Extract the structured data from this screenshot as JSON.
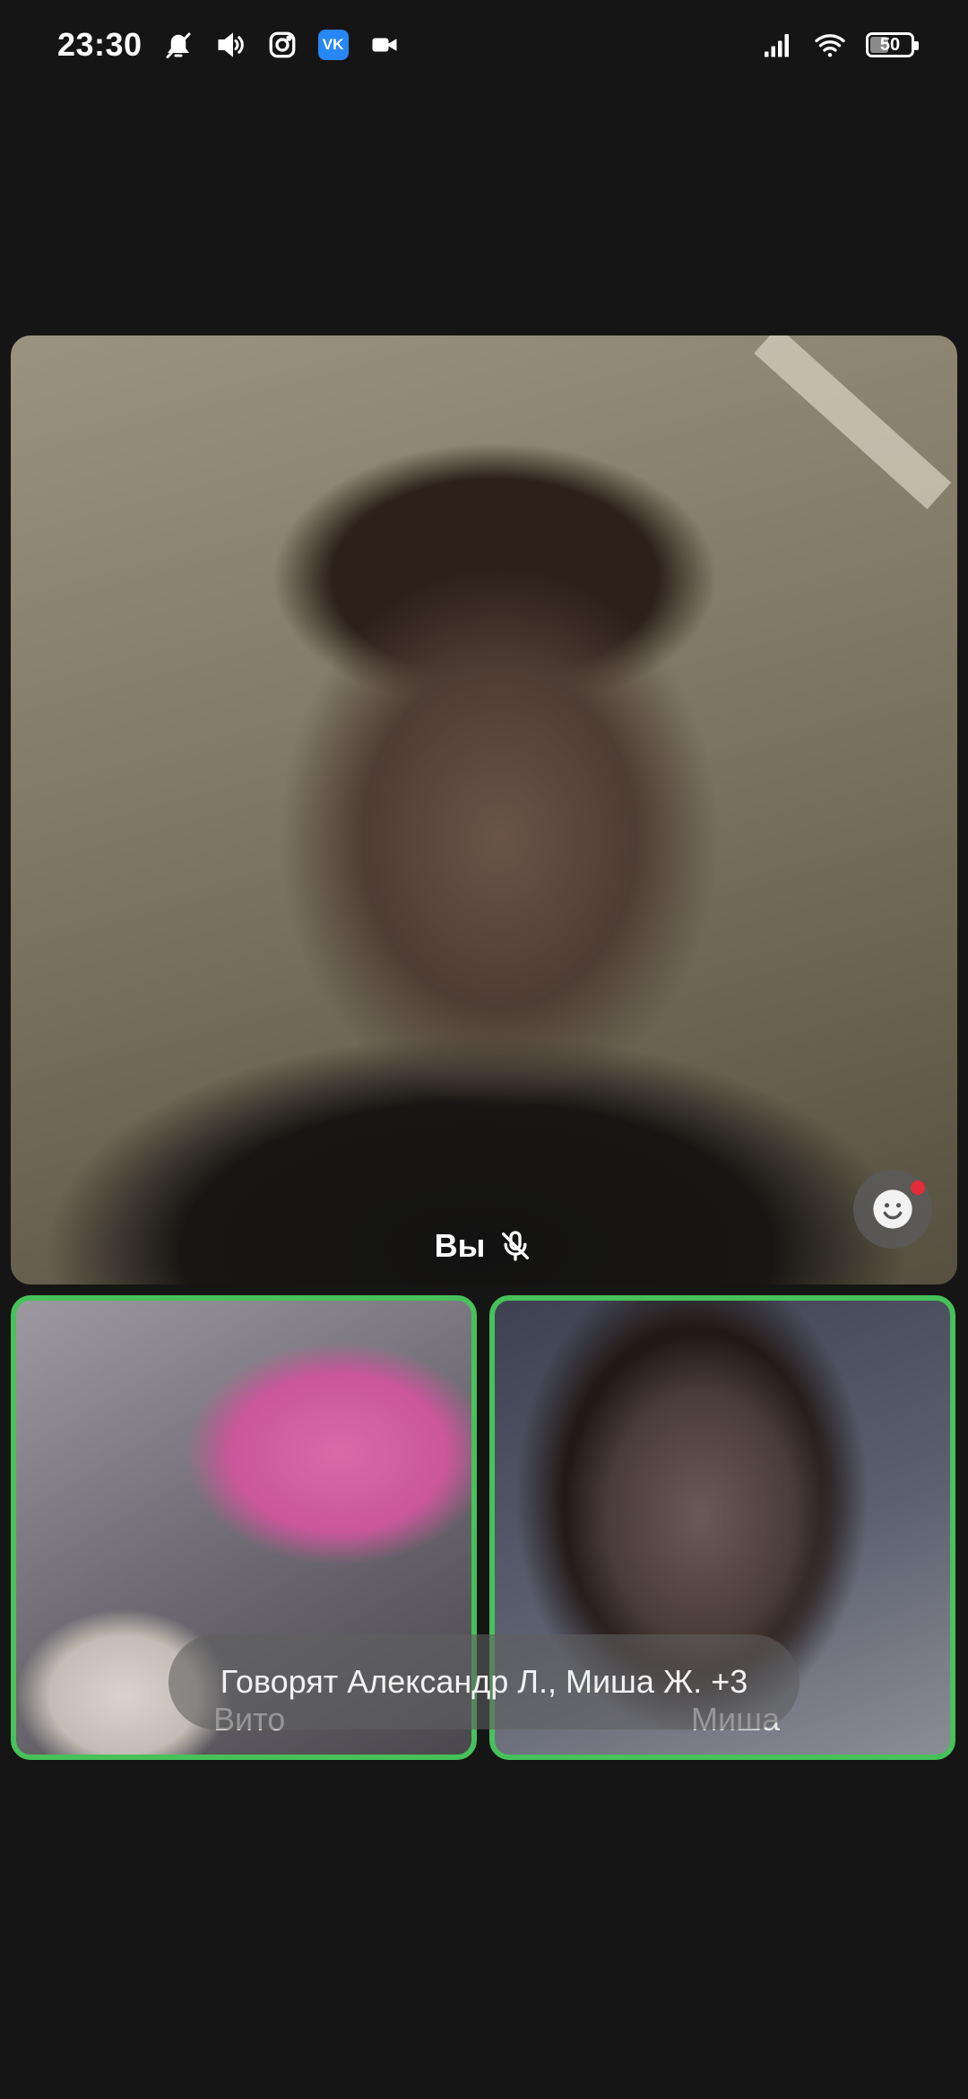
{
  "status_bar": {
    "time": "23:30",
    "battery": "50",
    "battery_level": 0.5,
    "icons": [
      "bell-muted-icon",
      "volume-icon",
      "instagram-icon",
      "vk-icon",
      "video-camera-icon",
      "signal-icon",
      "wifi-icon",
      "battery-icon"
    ],
    "vk_label": "VK"
  },
  "call": {
    "self_tile": {
      "name": "Вы",
      "mic_muted": true,
      "reaction_badge": true
    },
    "participants": [
      {
        "name": "Вито",
        "speaking": true
      },
      {
        "name": "Миша",
        "speaking": true
      }
    ],
    "speaking_banner": "Говорят Александр Л., Миша Ж. +3"
  },
  "colors": {
    "background": "#151515",
    "speaking_border": "#47c15a",
    "reaction_dot": "#e32b3a",
    "vk_brand": "#2787f5"
  }
}
